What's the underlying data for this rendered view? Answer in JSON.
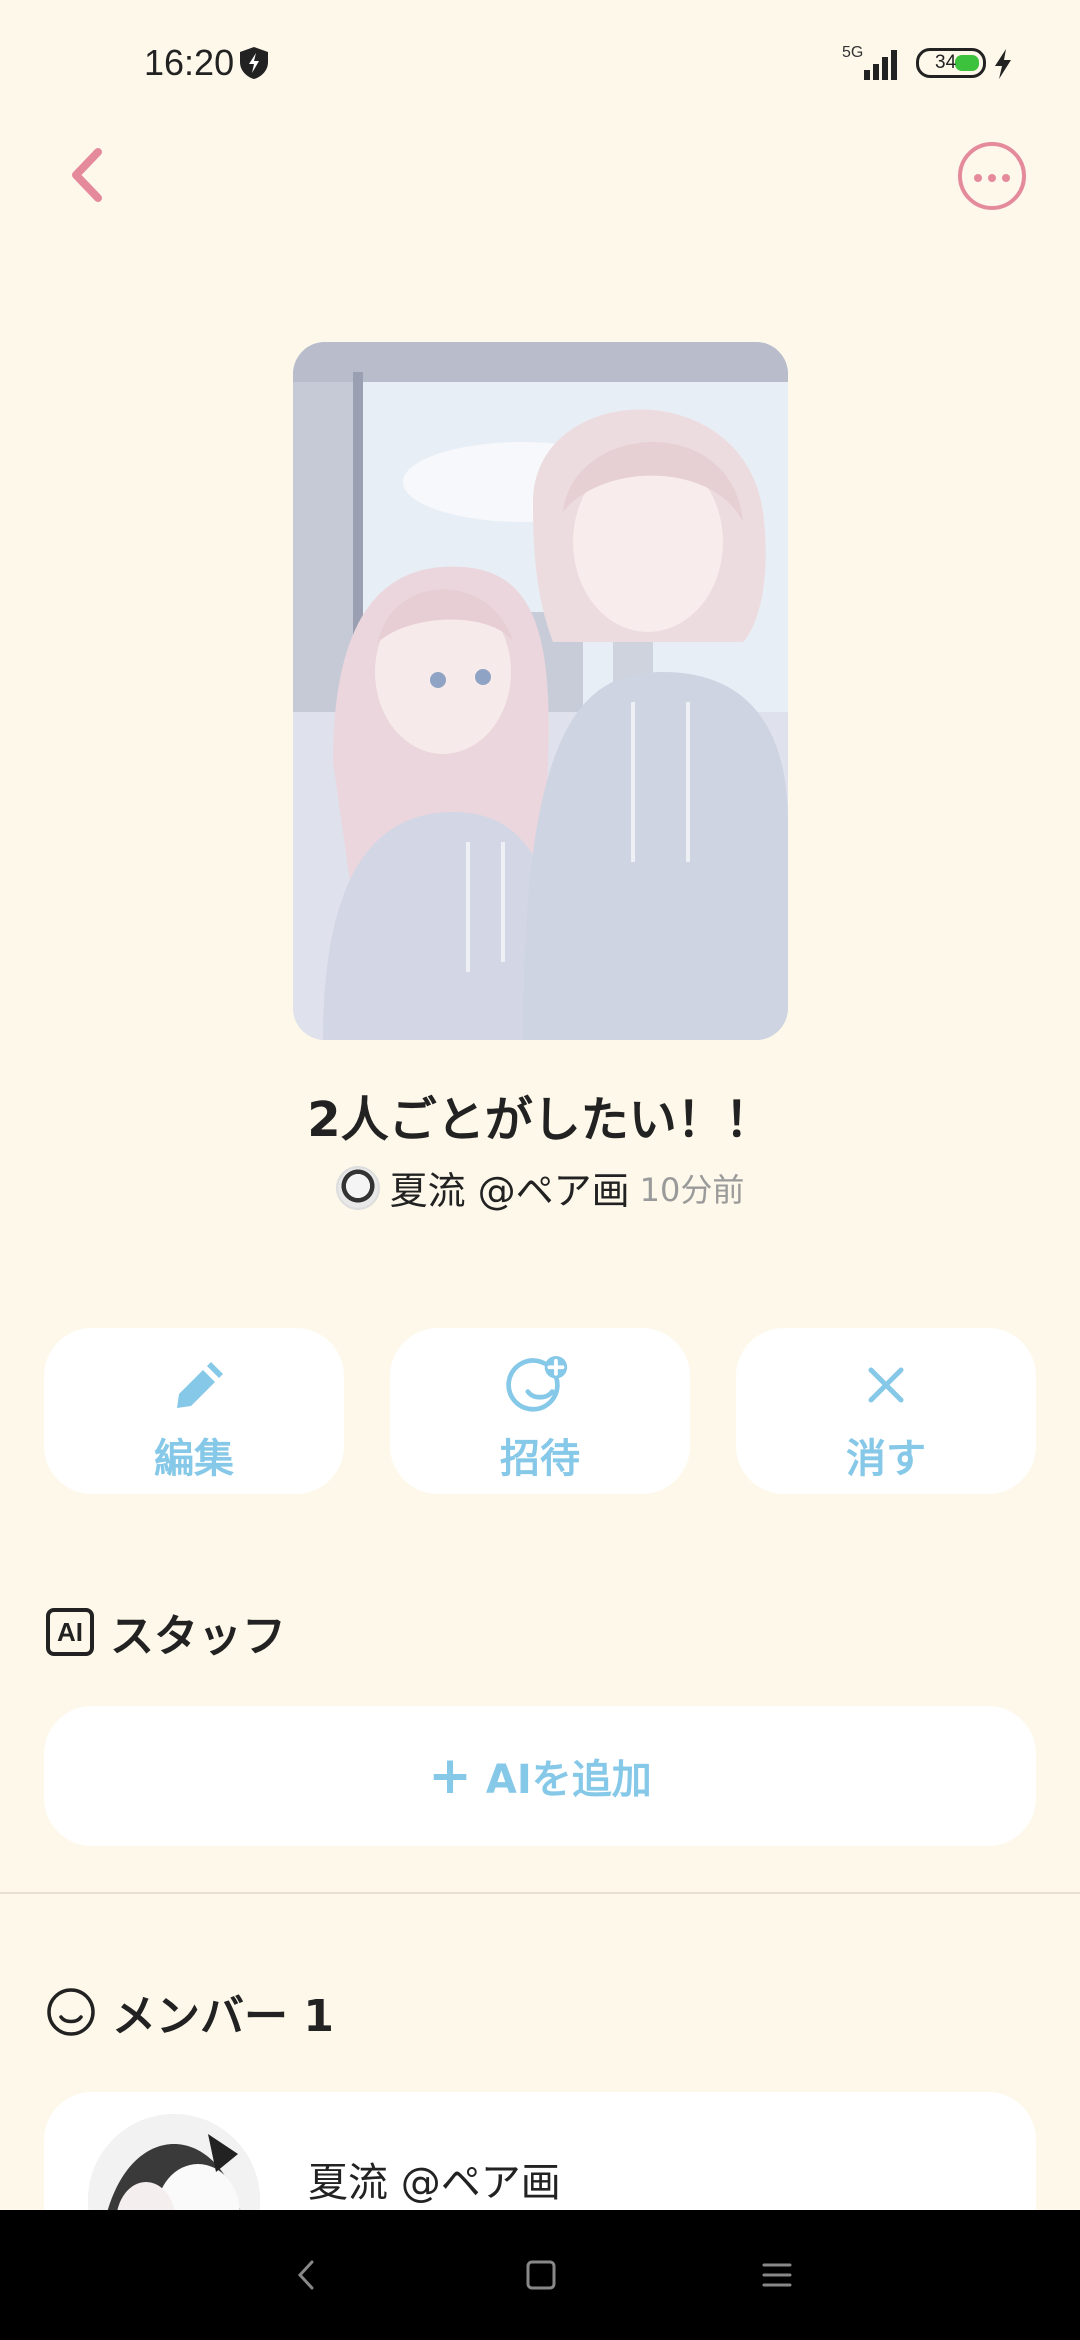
{
  "status": {
    "time": "16:20",
    "network": "5G",
    "battery": "34"
  },
  "header": {
    "back_icon": "chevron-left-icon",
    "more_icon": "more-horizontal-icon"
  },
  "room": {
    "title": "2人ごとがしたい！！",
    "author": "夏流 @ペア画",
    "time": "10分前"
  },
  "actions": [
    {
      "label": "編集",
      "icon": "pencil-icon"
    },
    {
      "label": "招待",
      "icon": "invite-smile-icon"
    },
    {
      "label": "消す",
      "icon": "close-icon"
    }
  ],
  "staff": {
    "title": "スタッフ",
    "badge": "AI",
    "add_label": "AIを追加"
  },
  "members": {
    "title": "メンバー 1",
    "items": [
      {
        "name": "夏流 @ペア画"
      }
    ]
  },
  "colors": {
    "background": "#fdf8ea",
    "accent_blue": "#86c8e8",
    "accent_pink": "#e58a9a"
  }
}
